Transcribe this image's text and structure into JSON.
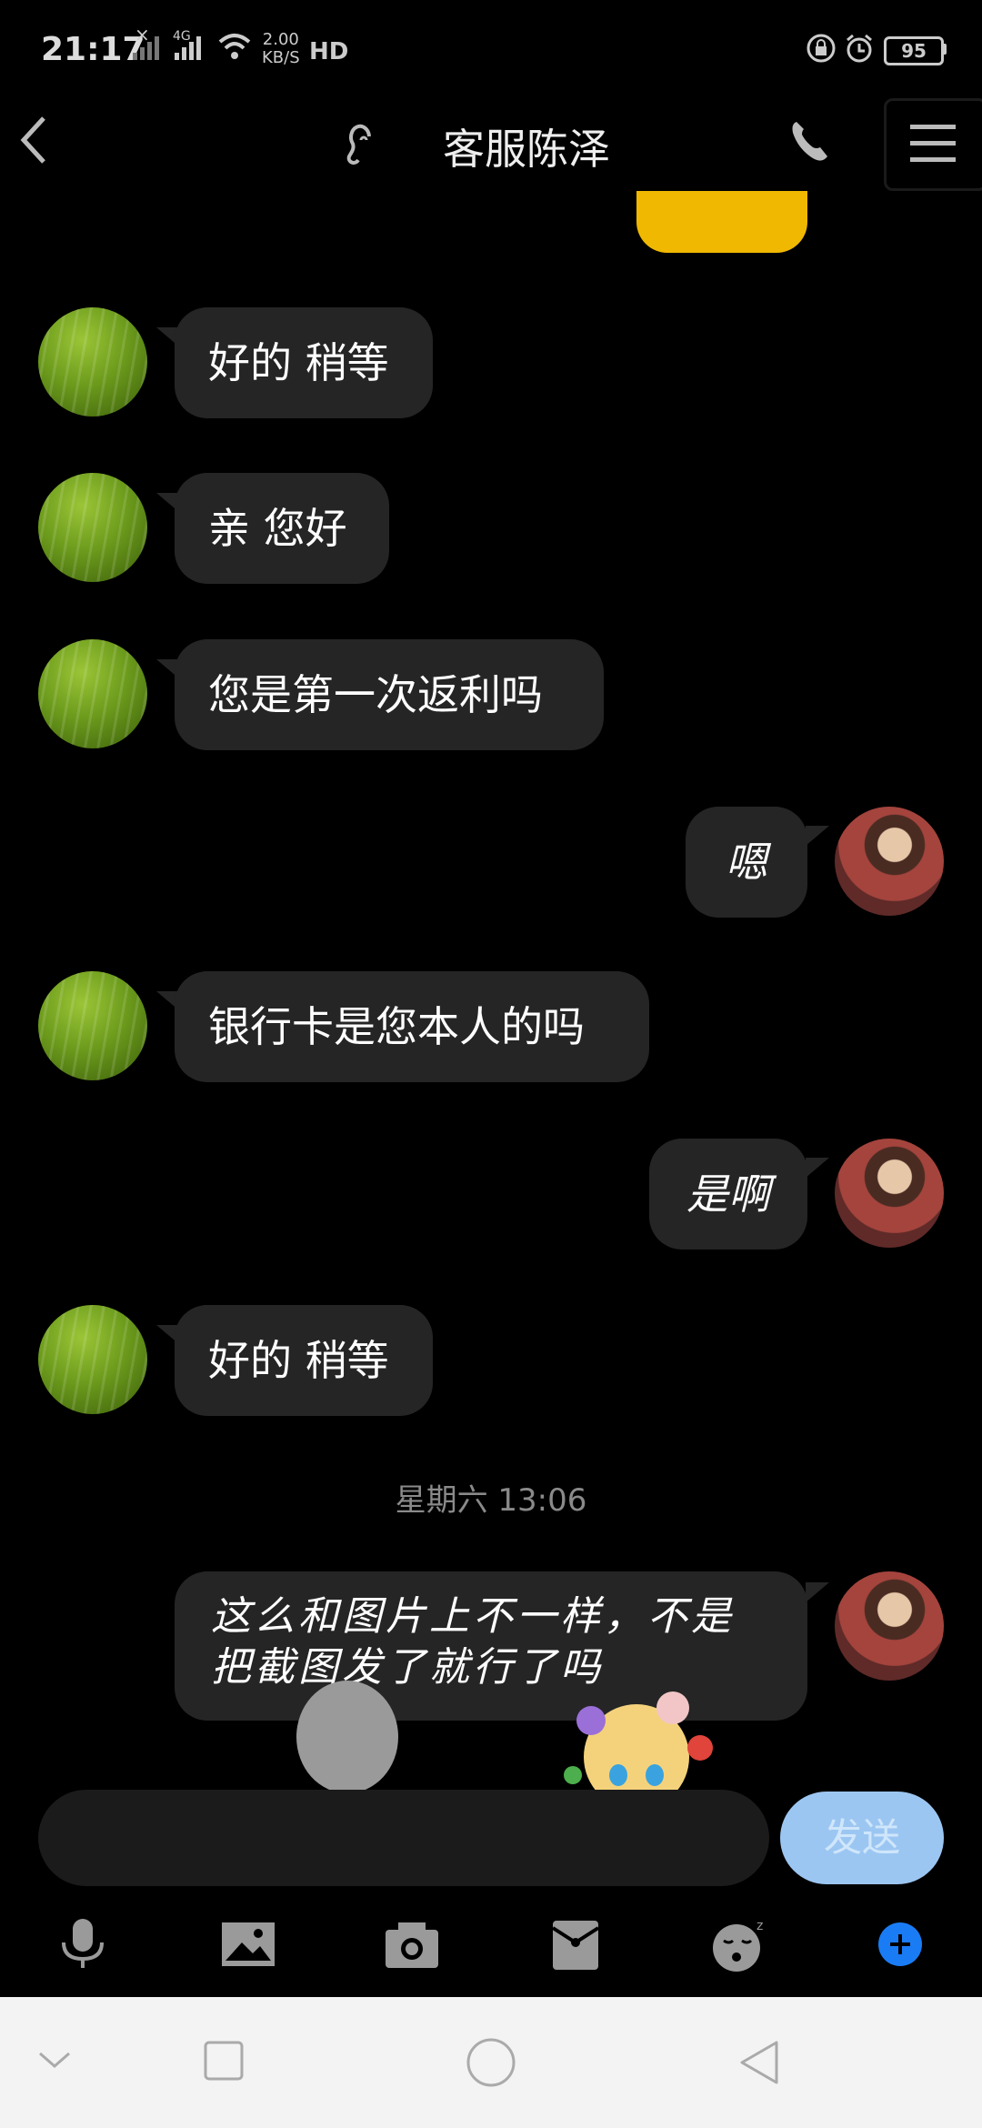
{
  "status_bar": {
    "time": "21:17",
    "signal1": "×",
    "network": "4G",
    "speed_value": "2.00",
    "speed_unit": "KB/S",
    "hd": "HD",
    "battery": "95"
  },
  "header": {
    "title": "客服陈泽"
  },
  "messages": [
    {
      "side": "left",
      "text": "好的 稍等"
    },
    {
      "side": "left",
      "text": "亲 您好"
    },
    {
      "side": "left",
      "text": "您是第一次返利吗"
    },
    {
      "side": "right",
      "text": "嗯"
    },
    {
      "side": "left",
      "text": "银行卡是您本人的吗"
    },
    {
      "side": "right",
      "text": "是啊"
    },
    {
      "side": "left",
      "text": "好的 稍等"
    },
    {
      "side": "right",
      "text": "这么和图片上不一样，不是把截图发了就行了吗"
    }
  ],
  "timestamp": "星期六 13:06",
  "input": {
    "value": "",
    "send_label": "发送"
  },
  "toolbar": {
    "icons": [
      "microphone-icon",
      "image-icon",
      "camera-icon",
      "red-packet-icon",
      "emoji-icon",
      "plus-icon"
    ]
  },
  "colors": {
    "accent_yellow": "#f0b800",
    "send_button": "#9cc6f2",
    "bubble": "#252525",
    "plus_blue": "#1a7cf5"
  }
}
